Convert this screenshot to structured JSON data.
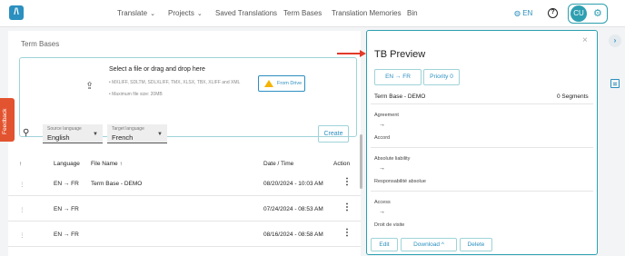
{
  "app": {
    "logo": "/\\"
  },
  "nav": {
    "items": [
      {
        "label": "Translate",
        "dropdown": true
      },
      {
        "label": "Projects",
        "dropdown": true
      },
      {
        "label": "Saved Translations"
      },
      {
        "label": "Term Bases"
      },
      {
        "label": "Translation Memories"
      },
      {
        "label": "Bin"
      }
    ],
    "language": "EN",
    "help": "?",
    "user_initials": "CU"
  },
  "main": {
    "title": "Term Bases",
    "dropzone": {
      "title": "Select a file or drag and drop here",
      "formats": "MXLIFF, SDLTM, SDLXLIFF, TMX, XLSX, TBX, XLIFF and XML",
      "max_size": "Maximum file size: 20MB",
      "drive_button": "From Drive"
    },
    "source_language": {
      "label": "Source language",
      "value": "English"
    },
    "target_language": {
      "label": "Target language",
      "value": "French"
    },
    "create_button": "Create",
    "table": {
      "headers": {
        "sort": "↑",
        "language": "Language",
        "file_name": "File Name",
        "file_name_sort": "↑",
        "date": "Date / Time",
        "action": "Action"
      },
      "rows": [
        {
          "language_from": "EN",
          "language_to": "FR",
          "arrow": "→",
          "file_name": "Term Base - DEMO",
          "date": "08/20/2024 - 10:03 AM"
        },
        {
          "language_from": "EN",
          "language_to": "FR",
          "arrow": "→",
          "file_name": "",
          "date": "07/24/2024 - 08:53 AM"
        },
        {
          "language_from": "EN",
          "language_to": "FR",
          "arrow": "→",
          "file_name": "",
          "date": "08/16/2024 - 08:58 AM"
        }
      ]
    }
  },
  "feedback": "Feedback",
  "preview": {
    "title": "TB Preview",
    "close": "×",
    "lang_chip": "EN → FR",
    "priority_chip": "Priority 0",
    "tb_name": "Term Base - DEMO",
    "segments": "0 Segments",
    "terms": [
      {
        "source": "Agreement",
        "arrow": "→",
        "target": "Accord"
      },
      {
        "source": "Absolute liability",
        "arrow": "→",
        "target": "Responsabilité absolue"
      },
      {
        "source": "Access",
        "arrow": "→",
        "target": "Droit de visite"
      }
    ],
    "buttons": {
      "edit": "Edit",
      "download": "Download",
      "download_caret": "^",
      "delete": "Delete"
    }
  },
  "colors": {
    "accent": "#2b8fbf",
    "teal": "#2b9fae",
    "feedback": "#e2532f",
    "arrow": "#e23a2a"
  },
  "icons": [
    "logo-icon",
    "globe-icon",
    "help-icon",
    "gear-icon",
    "upload-icon",
    "google-drive-icon",
    "search-icon",
    "kebab-icon",
    "close-icon",
    "chevron-right-icon",
    "edit-note-icon"
  ]
}
